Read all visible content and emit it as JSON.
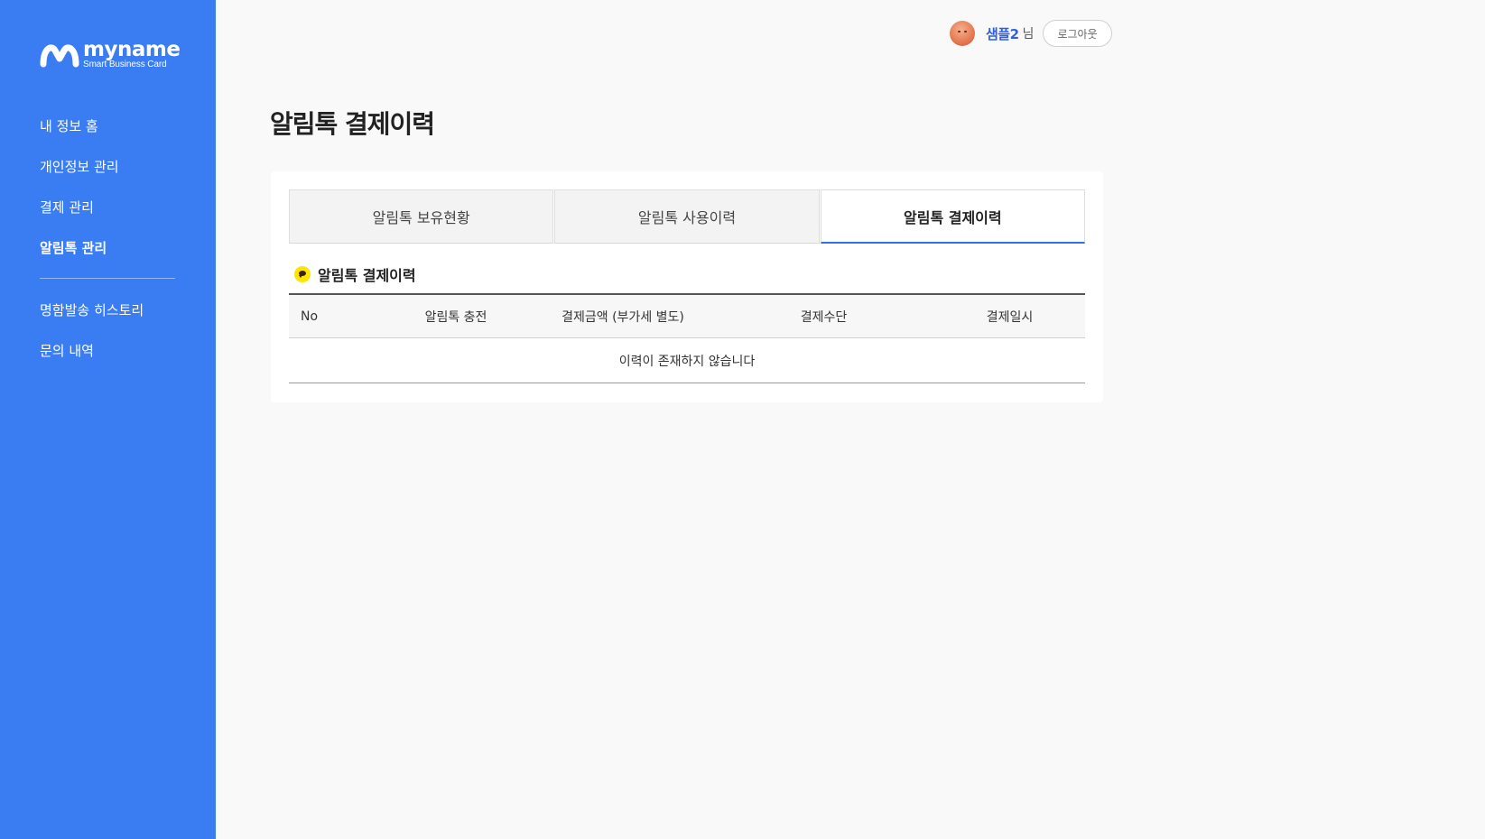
{
  "brand": {
    "name": "myname",
    "tagline": "Smart Business Card"
  },
  "sidebar": {
    "items": [
      {
        "label": "내 정보 홈"
      },
      {
        "label": "개인정보 관리"
      },
      {
        "label": "결제 관리"
      },
      {
        "label": "알림톡 관리",
        "active": true
      },
      {
        "label": "명함발송 히스토리"
      },
      {
        "label": "문의 내역"
      }
    ]
  },
  "header": {
    "user_name": "샘플2",
    "user_suffix": "님",
    "logout_label": "로그아웃"
  },
  "page": {
    "title": "알림톡 결제이력"
  },
  "tabs": [
    {
      "label": "알림톡 보유현황"
    },
    {
      "label": "알림톡 사용이력"
    },
    {
      "label": "알림톡 결제이력",
      "active": true
    }
  ],
  "section": {
    "title": "알림톡 결제이력",
    "icon": "kakao-talk-icon"
  },
  "table": {
    "columns": [
      "No",
      "알림톡 충전",
      "결제금액 (부가세 별도)",
      "결제수단",
      "결제일시"
    ],
    "empty_message": "이력이 존재하지 않습니다"
  },
  "colors": {
    "sidebar_bg": "#3a7cf2",
    "accent": "#2f6fe8",
    "user_name": "#2f5fe6",
    "kakao_yellow": "#fee500"
  }
}
